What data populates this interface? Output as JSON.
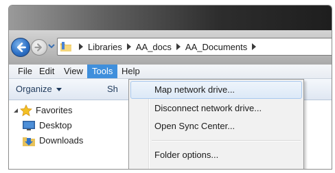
{
  "address_bar": {
    "breadcrumbs": [
      "Libraries",
      "AA_docs",
      "AA_Documents"
    ]
  },
  "menubar": {
    "items": [
      "File",
      "Edit",
      "View",
      "Tools",
      "Help"
    ],
    "active": "Tools"
  },
  "toolbar": {
    "organize_label": "Organize",
    "share_label_partial": "Sh"
  },
  "nav_pane": {
    "favorites_label": "Favorites",
    "items": [
      "Desktop",
      "Downloads"
    ]
  },
  "tools_menu": {
    "items": [
      "Map network drive...",
      "Disconnect network drive...",
      "Open Sync Center...",
      "Folder options..."
    ],
    "highlighted": "Map network drive..."
  },
  "colors": {
    "menu_active_bg": "#3f8fdc",
    "menu_highlight_border": "#a8c8ee",
    "toolbar_text": "#1e395b"
  },
  "icons": [
    "back-arrow-icon",
    "forward-arrow-icon",
    "history-dropdown-icon",
    "folder-icon",
    "breadcrumb-separator-icon",
    "chevron-down-icon",
    "star-icon",
    "desktop-icon",
    "downloads-icon"
  ]
}
